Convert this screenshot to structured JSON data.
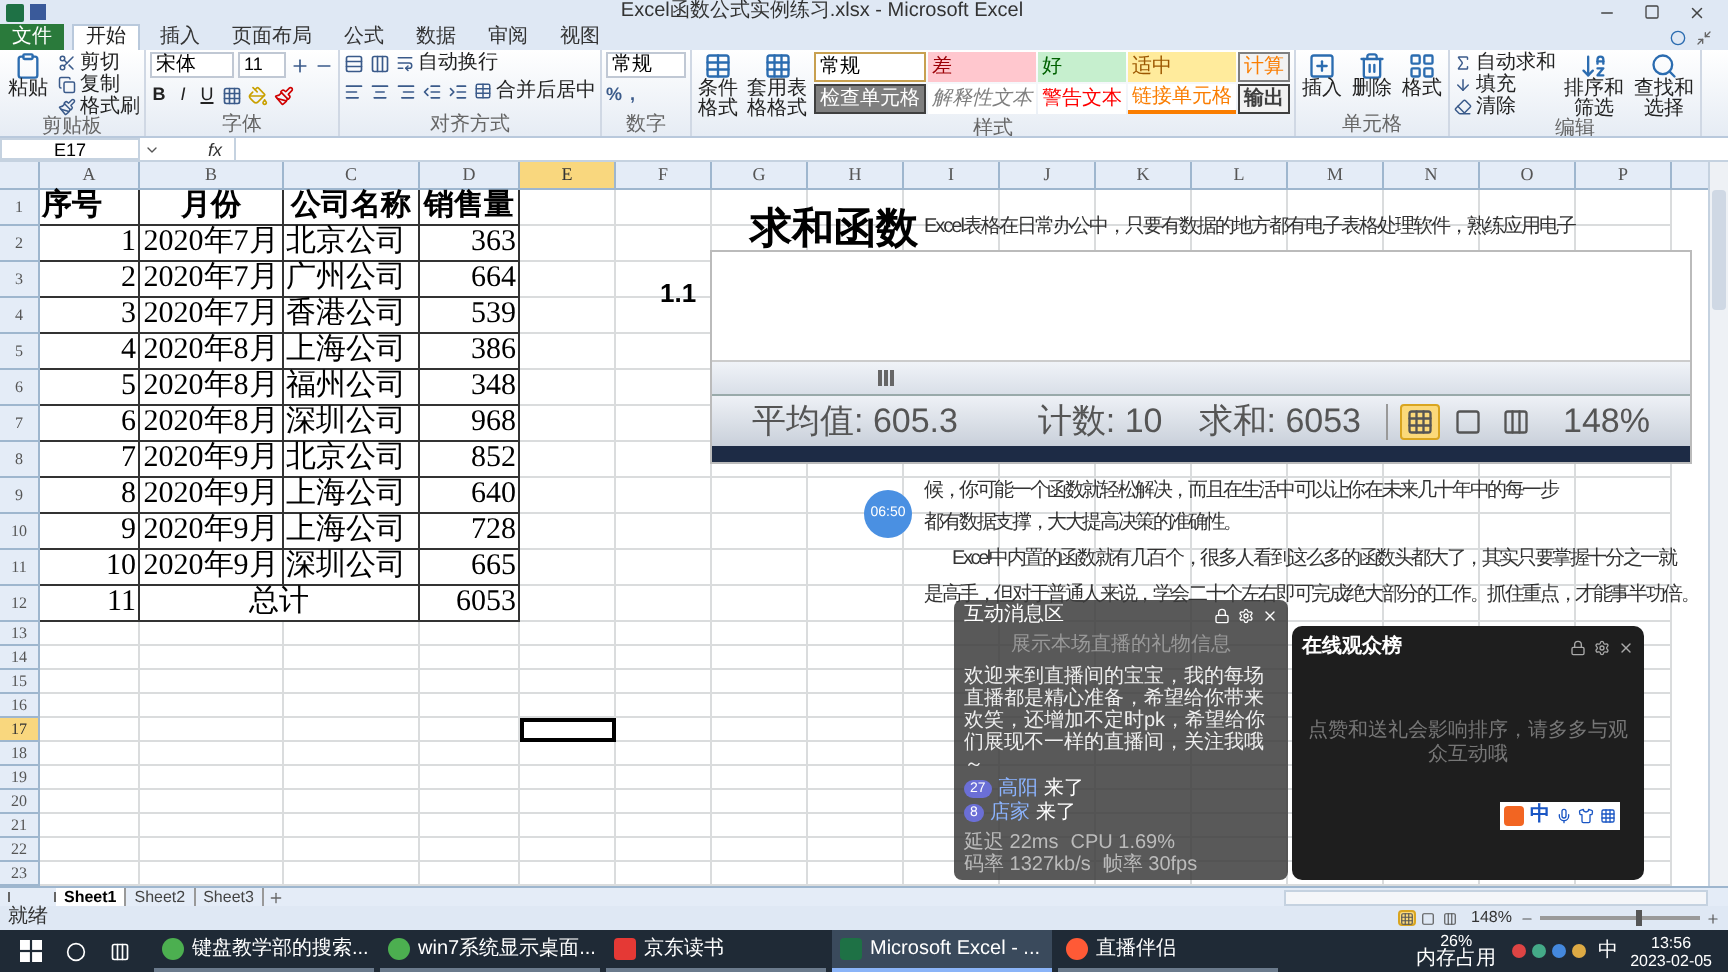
{
  "window": {
    "title": "Excel函数公式实例练习.xlsx - Microsoft Excel"
  },
  "ribbon_tabs": [
    {
      "label": "文件",
      "kind": "file",
      "selected": false
    },
    {
      "label": "开始",
      "kind": "tab",
      "selected": true
    },
    {
      "label": "插入",
      "kind": "tab",
      "selected": false
    },
    {
      "label": "页面布局",
      "kind": "tab",
      "selected": false
    },
    {
      "label": "公式",
      "kind": "tab",
      "selected": false
    },
    {
      "label": "数据",
      "kind": "tab",
      "selected": false
    },
    {
      "label": "审阅",
      "kind": "tab",
      "selected": false
    },
    {
      "label": "视图",
      "kind": "tab",
      "selected": false
    }
  ],
  "clipboard": {
    "label": "剪贴板",
    "paste": "粘贴",
    "items": [
      "剪切",
      "复制",
      "格式刷"
    ]
  },
  "font": {
    "label": "字体",
    "family": "宋体",
    "size": "11",
    "toggles": [
      "B",
      "I",
      "U"
    ]
  },
  "alignment": {
    "label": "对齐方式",
    "wrap": "自动换行",
    "merge": "合并后居中"
  },
  "number": {
    "label": "数字",
    "format": "常规",
    "symbols": [
      "%",
      ","
    ]
  },
  "styles": {
    "label": "样式",
    "buttons": [
      "条件格式",
      "套用表格格式"
    ],
    "cells": [
      {
        "label": "常规",
        "kind": "normal"
      },
      {
        "label": "差",
        "kind": "bad"
      },
      {
        "label": "好",
        "kind": "good"
      },
      {
        "label": "适中",
        "kind": "neutral"
      },
      {
        "label": "计算",
        "kind": "calc"
      },
      {
        "label": "检查单元格",
        "kind": "check"
      },
      {
        "label": "解释性文本",
        "kind": "explanatory"
      },
      {
        "label": "警告文本",
        "kind": "warning"
      },
      {
        "label": "链接单元格",
        "kind": "linked"
      },
      {
        "label": "输出",
        "kind": "output"
      }
    ]
  },
  "cells_group": {
    "label": "单元格",
    "buttons": [
      "插入",
      "删除",
      "格式"
    ]
  },
  "editing": {
    "label": "编辑",
    "items": [
      "自动求和",
      "填充",
      "清除"
    ],
    "buttons": [
      "排序和筛选",
      "查找和选择"
    ]
  },
  "formula_bar": {
    "name_box": "E17",
    "fx": "fx"
  },
  "columns": [
    {
      "label": "A",
      "selected": false
    },
    {
      "label": "B",
      "selected": false
    },
    {
      "label": "C",
      "selected": false
    },
    {
      "label": "D",
      "selected": false
    },
    {
      "label": "E",
      "selected": true
    },
    {
      "label": "F",
      "selected": false
    },
    {
      "label": "G",
      "selected": false
    },
    {
      "label": "H",
      "selected": false
    },
    {
      "label": "I",
      "selected": false
    },
    {
      "label": "J",
      "selected": false
    },
    {
      "label": "K",
      "selected": false
    },
    {
      "label": "L",
      "selected": false
    },
    {
      "label": "M",
      "selected": false
    },
    {
      "label": "N",
      "selected": false
    },
    {
      "label": "O",
      "selected": false
    },
    {
      "label": "P",
      "selected": false
    }
  ],
  "row_headers": [
    {
      "label": "1",
      "selected": false
    },
    {
      "label": "2",
      "selected": false
    },
    {
      "label": "3",
      "selected": false
    },
    {
      "label": "4",
      "selected": false
    },
    {
      "label": "5",
      "selected": false
    },
    {
      "label": "6",
      "selected": false
    },
    {
      "label": "7",
      "selected": false
    },
    {
      "label": "8",
      "selected": false
    },
    {
      "label": "9",
      "selected": false
    },
    {
      "label": "10",
      "selected": false
    },
    {
      "label": "11",
      "selected": false
    },
    {
      "label": "12",
      "selected": false
    },
    {
      "label": "13",
      "selected": false
    },
    {
      "label": "14",
      "selected": false
    },
    {
      "label": "15",
      "selected": false
    },
    {
      "label": "16",
      "selected": false
    },
    {
      "label": "17",
      "selected": true
    },
    {
      "label": "18",
      "selected": false
    },
    {
      "label": "19",
      "selected": false
    },
    {
      "label": "20",
      "selected": false
    },
    {
      "label": "21",
      "selected": false
    },
    {
      "label": "22",
      "selected": false
    },
    {
      "label": "23",
      "selected": false
    }
  ],
  "table": [
    {
      "kind": "header",
      "cells": [
        "序号",
        "月份",
        "公司名称",
        "销售量"
      ]
    },
    {
      "kind": "data",
      "cells": [
        "1",
        "2020年7月",
        "北京公司",
        "363"
      ]
    },
    {
      "kind": "data",
      "cells": [
        "2",
        "2020年7月",
        "广州公司",
        "664"
      ]
    },
    {
      "kind": "data",
      "cells": [
        "3",
        "2020年7月",
        "香港公司",
        "539"
      ]
    },
    {
      "kind": "data",
      "cells": [
        "4",
        "2020年8月",
        "上海公司",
        "386"
      ]
    },
    {
      "kind": "data",
      "cells": [
        "5",
        "2020年8月",
        "福州公司",
        "348"
      ]
    },
    {
      "kind": "data",
      "cells": [
        "6",
        "2020年8月",
        "深圳公司",
        "968"
      ]
    },
    {
      "kind": "data",
      "cells": [
        "7",
        "2020年9月",
        "北京公司",
        "852"
      ]
    },
    {
      "kind": "data",
      "cells": [
        "8",
        "2020年9月",
        "上海公司",
        "640"
      ]
    },
    {
      "kind": "data",
      "cells": [
        "9",
        "2020年9月",
        "上海公司",
        "728"
      ]
    },
    {
      "kind": "data",
      "cells": [
        "10",
        "2020年9月",
        "深圳公司",
        "665"
      ]
    },
    {
      "kind": "total",
      "cells": [
        "11",
        "总计",
        "6053"
      ]
    }
  ],
  "document": {
    "title": "求和函数",
    "section": "1.1",
    "first_line": "Excel表格在日常办公中，只要有数据的地方都有电子表格处理软件，熟练应用电子",
    "paragraphs": [
      {
        "lines": [
          "候，你可能一个函数就轻松解决，而且在生活中可以让你在未来几十年中的每一步",
          "都有数据支撑，大大提高决策的准确性。"
        ]
      },
      {
        "lines": [
          "Excel中内置的函数就有几百个，很多人看到这么多的函数头都大了，其实只要掌握十分之一就",
          "是高手，但对于普通人来说，学会二十个左右即可完成绝大部分的工作。抓住重点，才能事半功倍。"
        ]
      }
    ]
  },
  "inset_status": {
    "average": "平均值: 605.3",
    "count": "计数: 10",
    "sum": "求和: 6053",
    "zoom": "148%",
    "views": [
      {
        "kind": "normal",
        "selected": true
      },
      {
        "kind": "layout",
        "selected": false
      },
      {
        "kind": "pagebreak",
        "selected": false
      }
    ]
  },
  "timer": "06:50",
  "chat_panel": {
    "title": "互动消息区",
    "notice": "展示本场直播的礼物信息",
    "welcome": "欢迎来到直播间的宝宝，我的每场直播都是精心准备，希望给你带来欢笑，还增加不定时pk，希望给你们展现不一样的直播间，关注我哦～",
    "arrivals": [
      {
        "badge": "27",
        "name": "高阳",
        "text": "来了"
      },
      {
        "badge": "8",
        "name": "店家",
        "text": "来了"
      }
    ],
    "footer": [
      "延迟 22ms",
      "CPU 1.69%",
      "码率 1327kb/s",
      "帧率 30fps"
    ]
  },
  "audience_panel": {
    "title": "在线观众榜",
    "note": "点赞和送礼会影响排序，请多多与观众互动哦"
  },
  "ime_bar": {
    "mode": "中"
  },
  "sheet_tabs": [
    {
      "label": "Sheet1",
      "selected": true
    },
    {
      "label": "Sheet2",
      "selected": false
    },
    {
      "label": "Sheet3",
      "selected": false
    }
  ],
  "status_bar": {
    "ready": "就绪",
    "zoom": "148%",
    "zoom_slider": {
      "level": 0.6
    }
  },
  "taskbar": {
    "apps": [
      {
        "label": "键盘教学部的搜索...",
        "kind": "browser",
        "selected": false
      },
      {
        "label": "win7系统显示桌面...",
        "kind": "browser",
        "selected": false
      },
      {
        "label": "京东读书",
        "kind": "reader",
        "selected": false
      },
      {
        "label": "Microsoft Excel - ...",
        "kind": "excel",
        "selected": true
      },
      {
        "label": "直播伴侣",
        "kind": "live",
        "selected": false
      }
    ],
    "memory": "26%",
    "memory_label": "内存占用",
    "ime": "中",
    "time": "13:56",
    "date": "2023-02-05"
  }
}
